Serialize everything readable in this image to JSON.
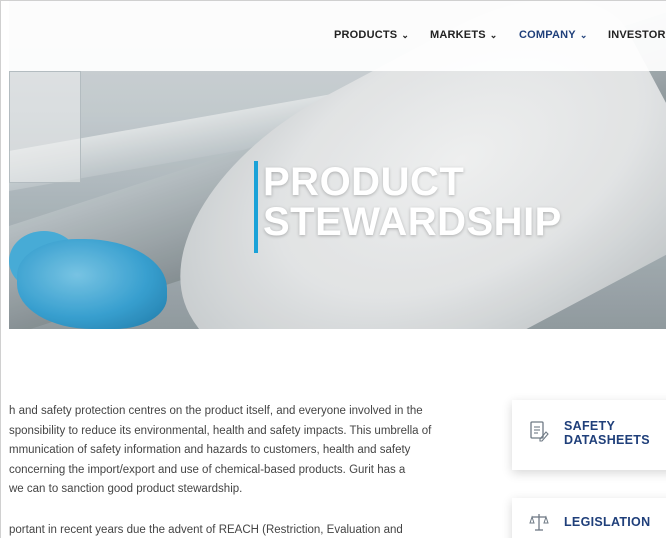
{
  "nav": {
    "items": [
      {
        "label": "PRODUCTS",
        "chevron": "⌄",
        "active": false
      },
      {
        "label": "MARKETS",
        "chevron": "⌄",
        "active": false
      },
      {
        "label": "COMPANY",
        "chevron": "⌄",
        "active": true
      },
      {
        "label": "INVESTORS",
        "chevron": "",
        "active": false
      }
    ],
    "active_color": "#1f3f7a"
  },
  "hero": {
    "title_line1": "PRODUCT",
    "title_line2": "STEWARDSHIP",
    "accent_color": "#1aa2d8"
  },
  "content": {
    "paragraph1": [
      "h and safety protection centres on the product itself, and everyone involved in the",
      "sponsibility to reduce its environmental, health and safety impacts. This umbrella of",
      "mmunication of safety information and hazards to customers, health and safety",
      "concerning the import/export and use of chemical-based products. Gurit has a",
      "we can to sanction good product stewardship."
    ],
    "paragraph2": [
      "portant in recent years due the advent of REACH (Restriction, Evaluation and"
    ]
  },
  "sidebar_links": [
    {
      "label_line1": "SAFETY",
      "label_line2": "DATASHEETS",
      "icon": "document-edit-icon"
    },
    {
      "label_line1": "LEGISLATION",
      "label_line2": "",
      "icon": "scales-icon"
    }
  ]
}
